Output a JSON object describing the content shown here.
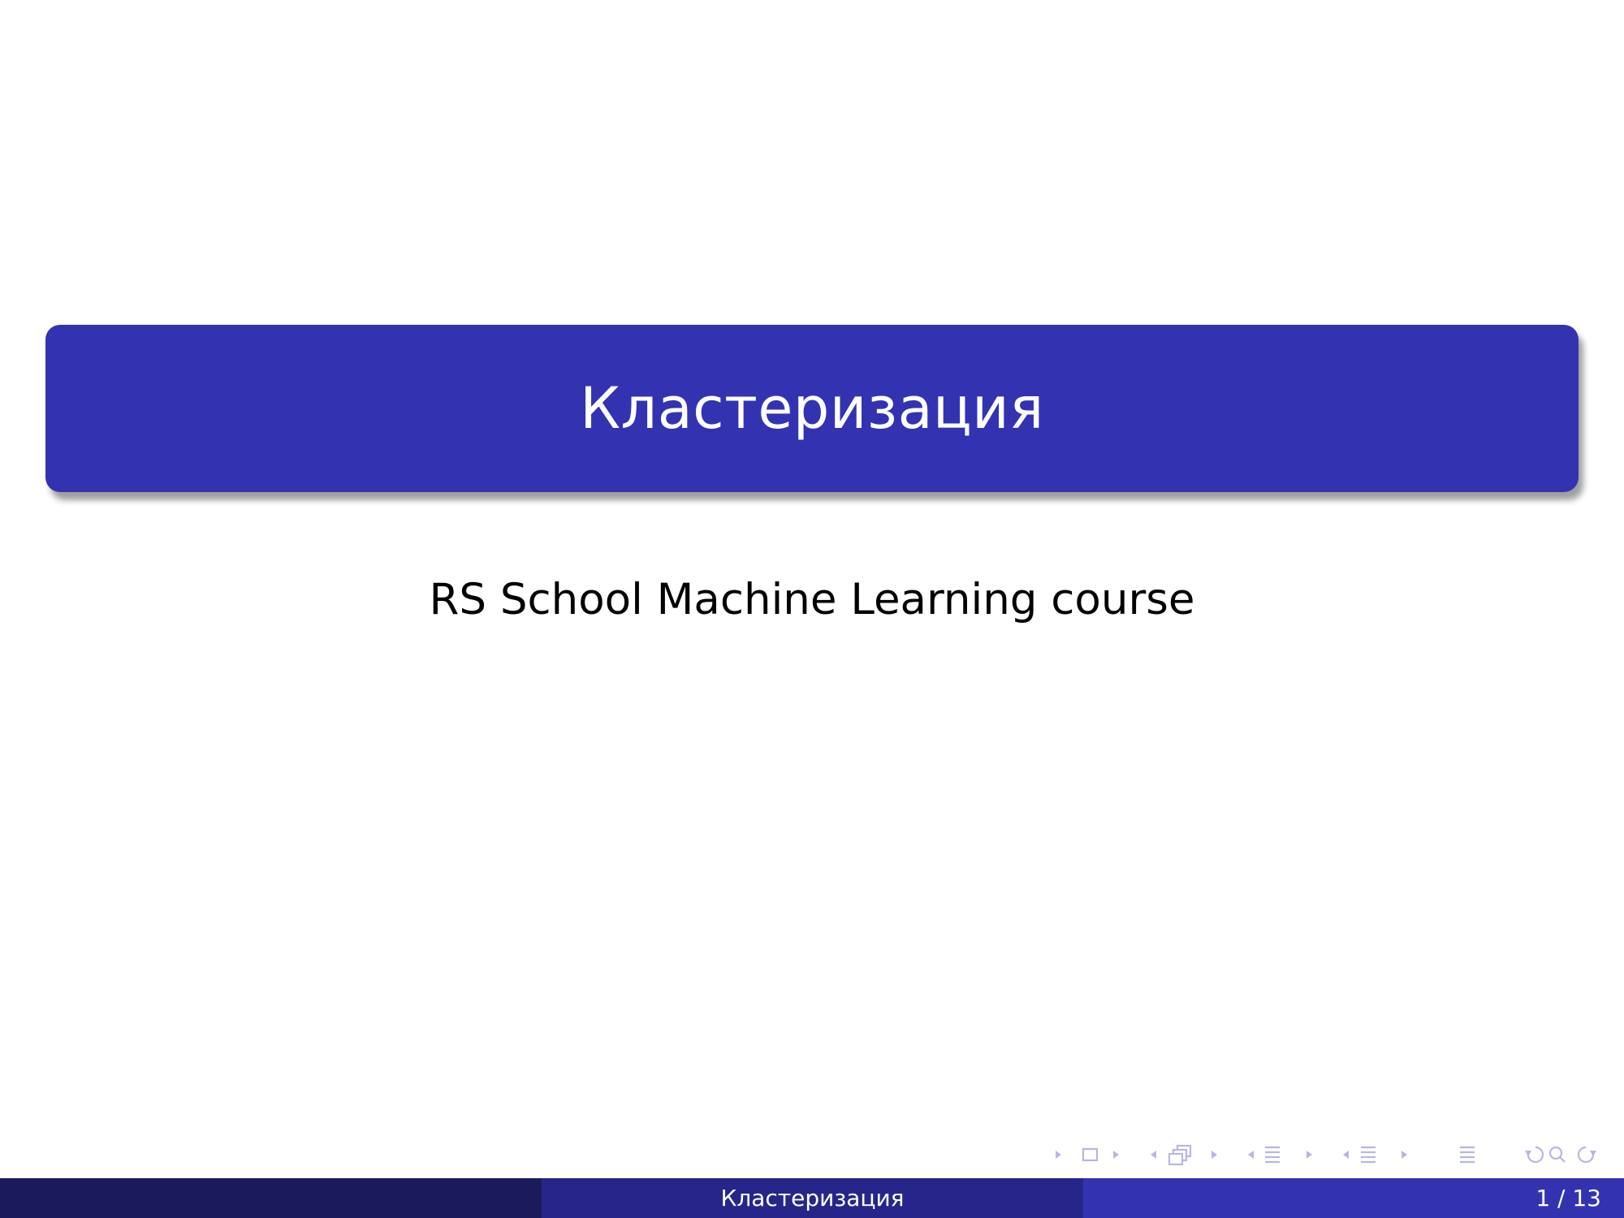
{
  "slide": {
    "title": "Кластеризация",
    "subtitle": "RS School Machine Learning course"
  },
  "footer": {
    "left_text": "",
    "center_title": "Кластеризация",
    "page_indicator": "1 / 13"
  },
  "navigation": {
    "icons": [
      "prev-frame-arrow-icon",
      "frame-icon",
      "next-frame-arrow-icon",
      "prev-subsection-arrow-icon",
      "subsection-icon",
      "next-subsection-arrow-icon",
      "prev-section-arrow-icon",
      "section-icon",
      "next-section-arrow-icon",
      "prev-doc-arrow-icon",
      "document-icon",
      "next-doc-arrow-icon",
      "back-icon",
      "search-icon",
      "forward-icon"
    ]
  },
  "colors": {
    "title_bg": "#3333b2",
    "footer_left": "#1b1b5c",
    "footer_mid": "#26268a",
    "footer_right": "#3333b2",
    "nav_symbol": "#b7b7e0"
  }
}
